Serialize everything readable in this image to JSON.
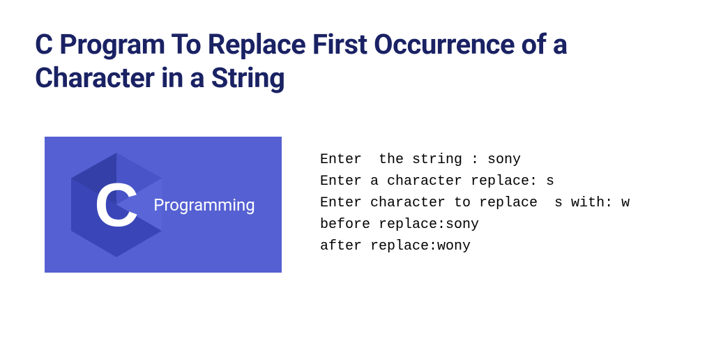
{
  "title": "C Program To Replace First Occurrence of a Character in a String",
  "logo": {
    "letter": "C",
    "label": "Programming"
  },
  "output": {
    "line1": "Enter  the string : sony",
    "line2": "Enter a character replace: s",
    "line3": "Enter character to replace  s with: w",
    "line4": "before replace:sony",
    "line5": "after replace:wony"
  }
}
